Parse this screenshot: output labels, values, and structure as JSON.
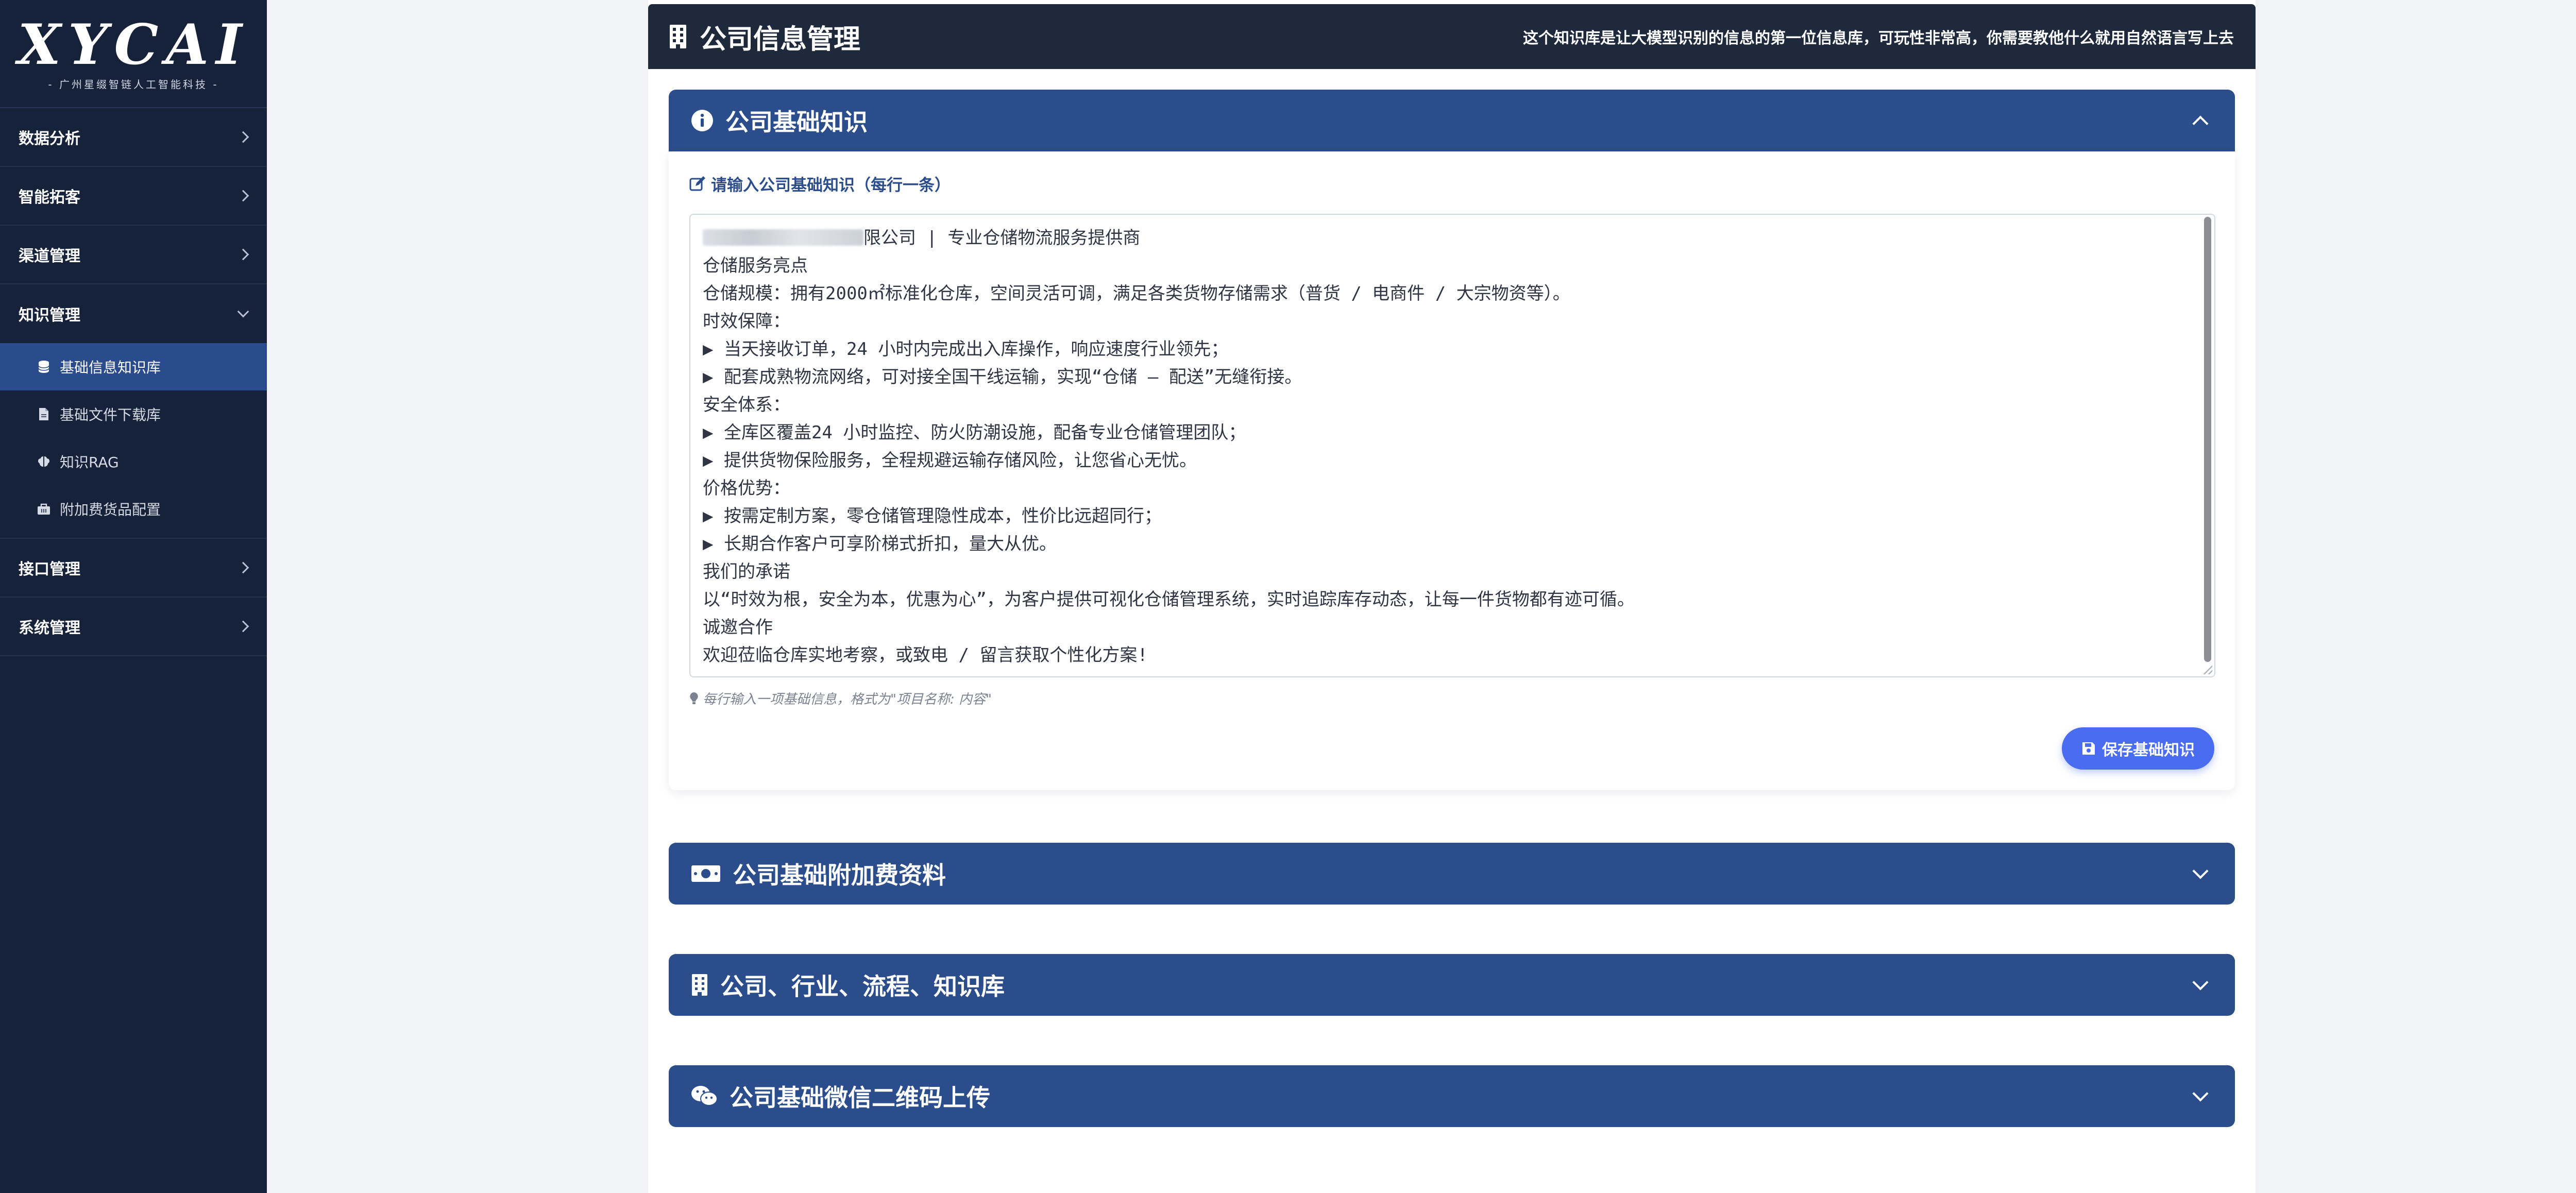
{
  "sidebar": {
    "logo": "XYCAI",
    "logo_sub": "- 广州星缀智链人工智能科技 -",
    "items": [
      {
        "label": "数据分析"
      },
      {
        "label": "智能拓客"
      },
      {
        "label": "渠道管理"
      },
      {
        "label": "知识管理"
      },
      {
        "label": "接口管理"
      },
      {
        "label": "系统管理"
      }
    ],
    "knowledge_sub": [
      {
        "label": "基础信息知识库",
        "icon": "database-icon"
      },
      {
        "label": "基础文件下载库",
        "icon": "file-icon"
      },
      {
        "label": "知识RAG",
        "icon": "brain-icon"
      },
      {
        "label": "附加费货品配置",
        "icon": "briefcase-icon"
      }
    ]
  },
  "header": {
    "title": "公司信息管理",
    "note": "这个知识库是让大模型识别的信息的第一位信息库，可玩性非常高，你需要教他什么就用自然语言写上去"
  },
  "panels": {
    "basic": {
      "title": "公司基础知识",
      "field_label": "请输入公司基础知识（每行一条）",
      "line1_suffix": "限公司 | 专业仓储物流服务提供商",
      "content_rest": "仓储服务亮点\n仓储规模：拥有2000㎡标准化仓库，空间灵活可调，满足各类货物存储需求（普货 / 电商件 / 大宗物资等）。\n时效保障：\n▶ 当天接收订单，24 小时内完成出入库操作，响应速度行业领先；\n▶ 配套成熟物流网络，可对接全国干线运输，实现“仓储 – 配送”无缝衔接。\n安全体系：\n▶ 全库区覆盖24 小时监控、防火防潮设施，配备专业仓储管理团队；\n▶ 提供货物保险服务，全程规避运输存储风险，让您省心无忧。\n价格优势：\n▶ 按需定制方案，零仓储管理隐性成本，性价比远超同行；\n▶ 长期合作客户可享阶梯式折扣，量大从优。\n我们的承诺\n以“时效为根，安全为本，优惠为心”，为客户提供可视化仓储管理系统，实时追踪库存动态，让每一件货物都有迹可循。\n诚邀合作\n欢迎莅临仓库实地考察，或致电 / 留言获取个性化方案!",
      "hint": "每行输入一项基础信息，格式为\"项目名称: 内容\"",
      "save_label": "保存基础知识"
    },
    "surcharge": {
      "title": "公司基础附加费资料"
    },
    "industry": {
      "title": "公司、行业、流程、知识库"
    },
    "wechat": {
      "title": "公司基础微信二维码上传"
    }
  },
  "colors": {
    "sidebar_bg": "#16213a",
    "header_bg": "#1e2a3c",
    "panel_head": "#2b4d8b",
    "active_item": "#2b4c8c",
    "save_button": "#4a6cf0"
  }
}
